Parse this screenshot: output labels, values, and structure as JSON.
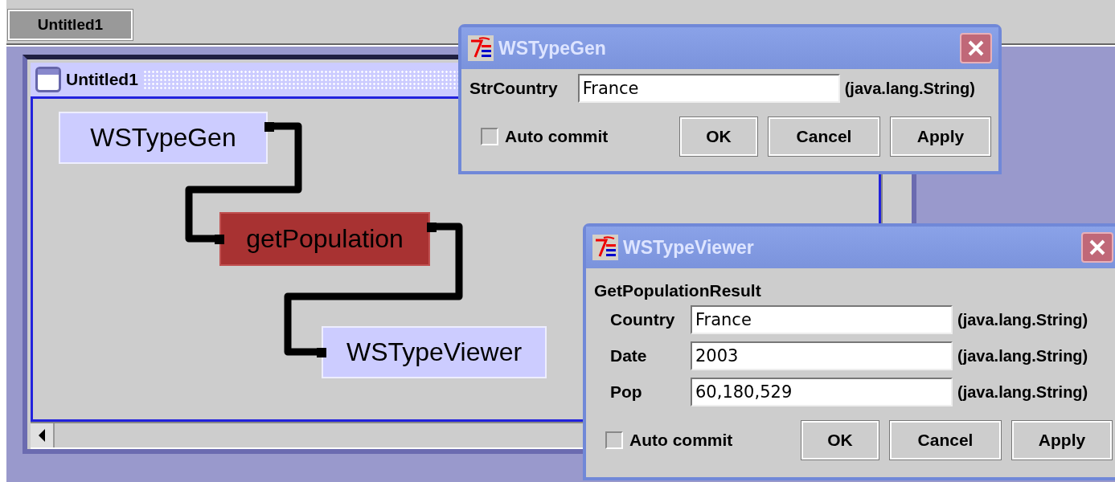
{
  "taskbar": {
    "tabs": [
      {
        "label": "Untitled1",
        "selected": true
      }
    ]
  },
  "frame": {
    "title": "Untitled1",
    "nodes": [
      {
        "label": "WSTypeGen",
        "selected": false
      },
      {
        "label": "getPopulation",
        "selected": true
      },
      {
        "label": "WSTypeViewer",
        "selected": false
      }
    ]
  },
  "dialogs": [
    {
      "title": "WSTypeGen",
      "fields": [
        {
          "label": "StrCountry",
          "value": "France",
          "type": "(java.lang.String)"
        }
      ],
      "auto_commit": {
        "label": "Auto commit",
        "checked": false
      },
      "buttons": [
        "OK",
        "Cancel",
        "Apply"
      ]
    },
    {
      "title": "WSTypeViewer",
      "heading": "GetPopulationResult",
      "fields": [
        {
          "label": "Country",
          "value": "France",
          "type": "(java.lang.String)"
        },
        {
          "label": "Date",
          "value": "2003",
          "type": "(java.lang.String)"
        },
        {
          "label": "Pop",
          "value": "60,180,529",
          "type": "(java.lang.String)"
        }
      ],
      "auto_commit": {
        "label": "Auto commit",
        "checked": false
      },
      "buttons": [
        "OK",
        "Cancel",
        "Apply"
      ]
    }
  ]
}
